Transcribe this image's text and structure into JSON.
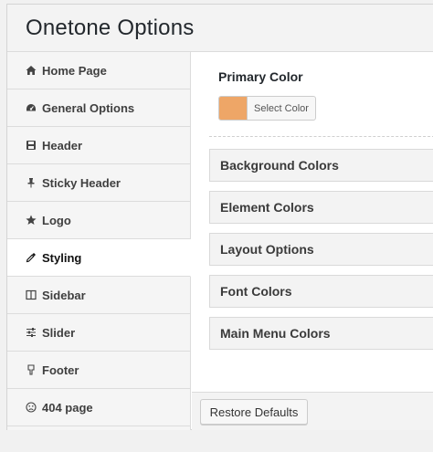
{
  "header": {
    "title": "Onetone Options"
  },
  "sidebar": {
    "items": [
      {
        "label": "Home Page",
        "icon": "home-icon",
        "active": false
      },
      {
        "label": "General Options",
        "icon": "dashboard-icon",
        "active": false
      },
      {
        "label": "Header",
        "icon": "save-icon",
        "active": false
      },
      {
        "label": "Sticky Header",
        "icon": "pin-icon",
        "active": false
      },
      {
        "label": "Logo",
        "icon": "star-icon",
        "active": false
      },
      {
        "label": "Styling",
        "icon": "eyedropper-icon",
        "active": true
      },
      {
        "label": "Sidebar",
        "icon": "columns-icon",
        "active": false
      },
      {
        "label": "Slider",
        "icon": "sliders-icon",
        "active": false
      },
      {
        "label": "Footer",
        "icon": "hand-down-icon",
        "active": false
      },
      {
        "label": "404 page",
        "icon": "sad-face-icon",
        "active": false
      }
    ]
  },
  "main": {
    "primary_color": {
      "label": "Primary Color",
      "button_label": "Select Color",
      "value": "#eea667"
    },
    "sections": [
      {
        "label": "Background Colors"
      },
      {
        "label": "Element Colors"
      },
      {
        "label": "Layout Options"
      },
      {
        "label": "Font Colors"
      },
      {
        "label": "Main Menu Colors"
      }
    ]
  },
  "footer": {
    "restore_label": "Restore Defaults"
  }
}
